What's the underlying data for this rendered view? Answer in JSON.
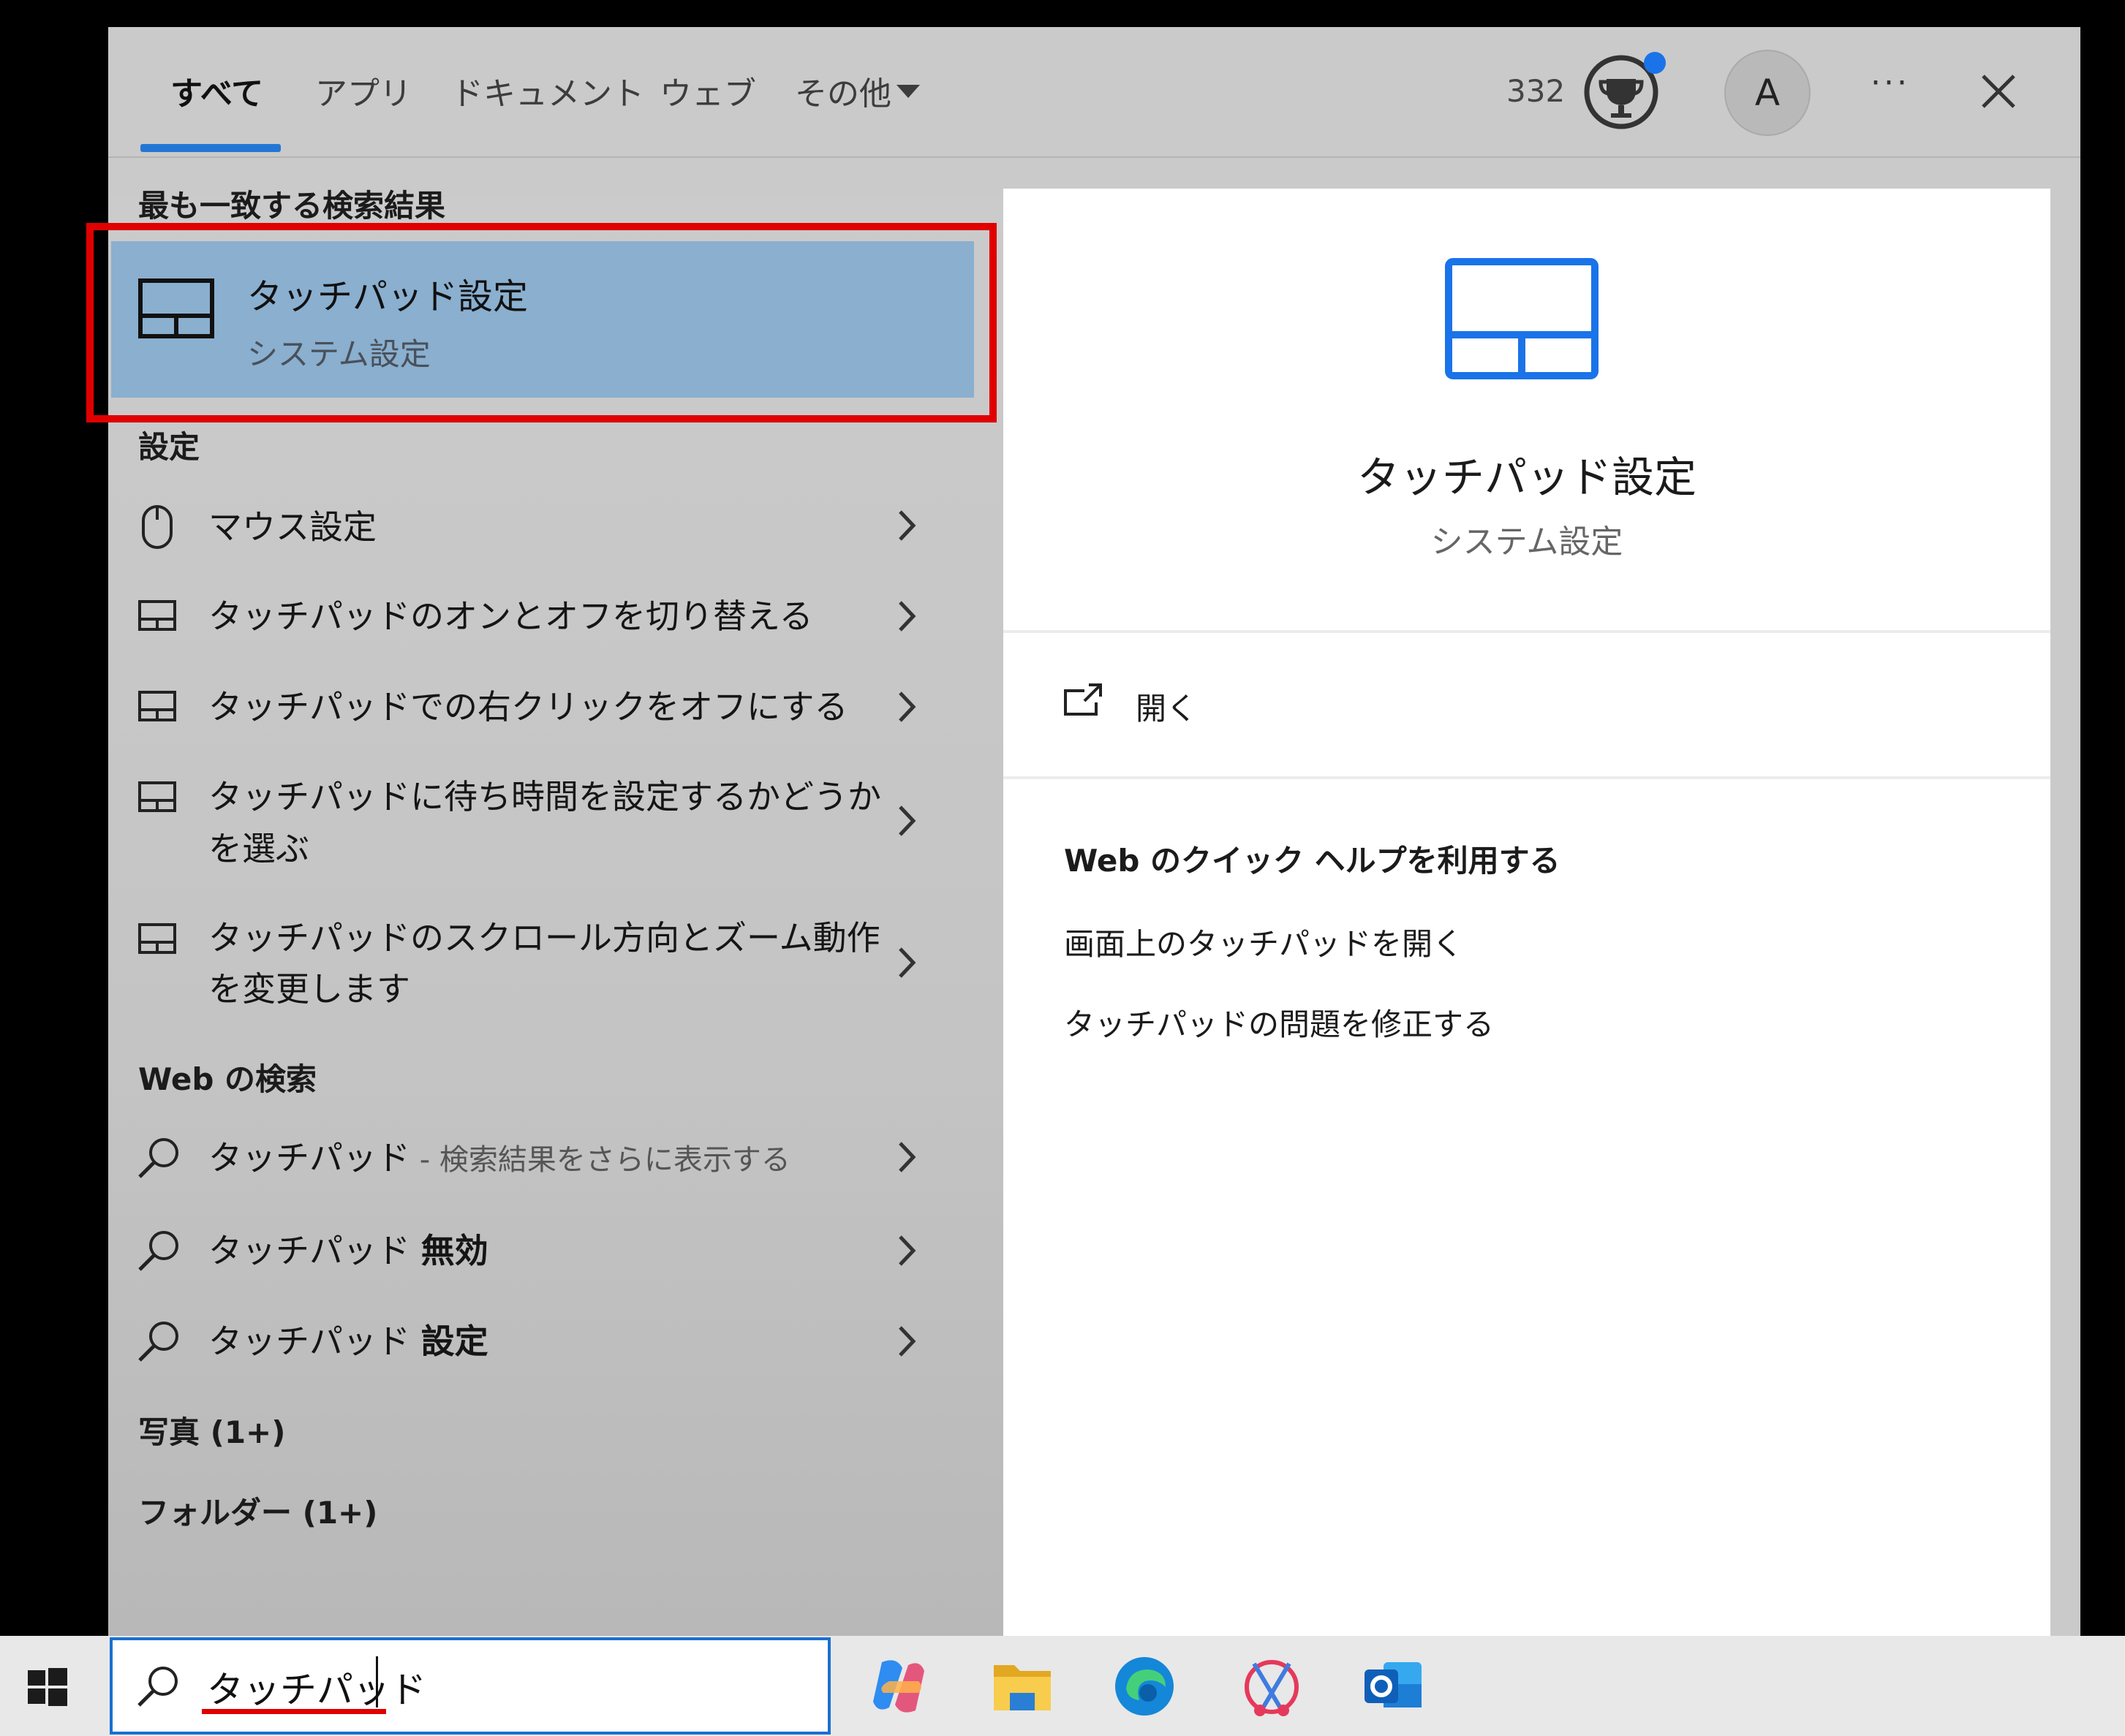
{
  "tabs": {
    "all": "すべて",
    "apps": "アプリ",
    "documents": "ドキュメント",
    "web": "ウェブ",
    "more": "その他"
  },
  "header": {
    "points": "332",
    "avatar_letter": "A",
    "more_label": "···"
  },
  "sections": {
    "best_match": "最も一致する検索結果",
    "settings": "設定",
    "web_search": "Web の検索",
    "photos": "写真 (1+)",
    "folders": "フォルダー (1+)"
  },
  "best_match": {
    "title": "タッチパッド設定",
    "subtitle": "システム設定"
  },
  "settings_items": [
    {
      "line1": "マウス設定",
      "line2": ""
    },
    {
      "line1": "タッチパッドのオンとオフを切り替える",
      "line2": ""
    },
    {
      "line1": "タッチパッドでの右クリックをオフにする",
      "line2": ""
    },
    {
      "line1": "タッチパッドに待ち時間を設定するかどうか",
      "line2": "を選ぶ"
    },
    {
      "line1": "タッチパッドのスクロール方向とズーム動作",
      "line2": "を変更します"
    }
  ],
  "web_items": [
    {
      "query": "タッチパッド",
      "hint": " - 検索結果をさらに表示する"
    },
    {
      "query": "タッチパッド",
      "bold": "無効"
    },
    {
      "query": "タッチパッド",
      "bold": "設定"
    }
  ],
  "preview": {
    "title": "タッチパッド設定",
    "subtitle": "システム設定",
    "open_label": "開く",
    "help_heading": "Web のクイック ヘルプを利用する",
    "help_links": [
      "画面上のタッチパッドを開く",
      "タッチパッドの問題を修正する"
    ]
  },
  "search": {
    "value": "タッチパッド"
  },
  "colors": {
    "accent": "#2277d4",
    "highlight": "#8aafcf",
    "annotation": "#e00000"
  }
}
